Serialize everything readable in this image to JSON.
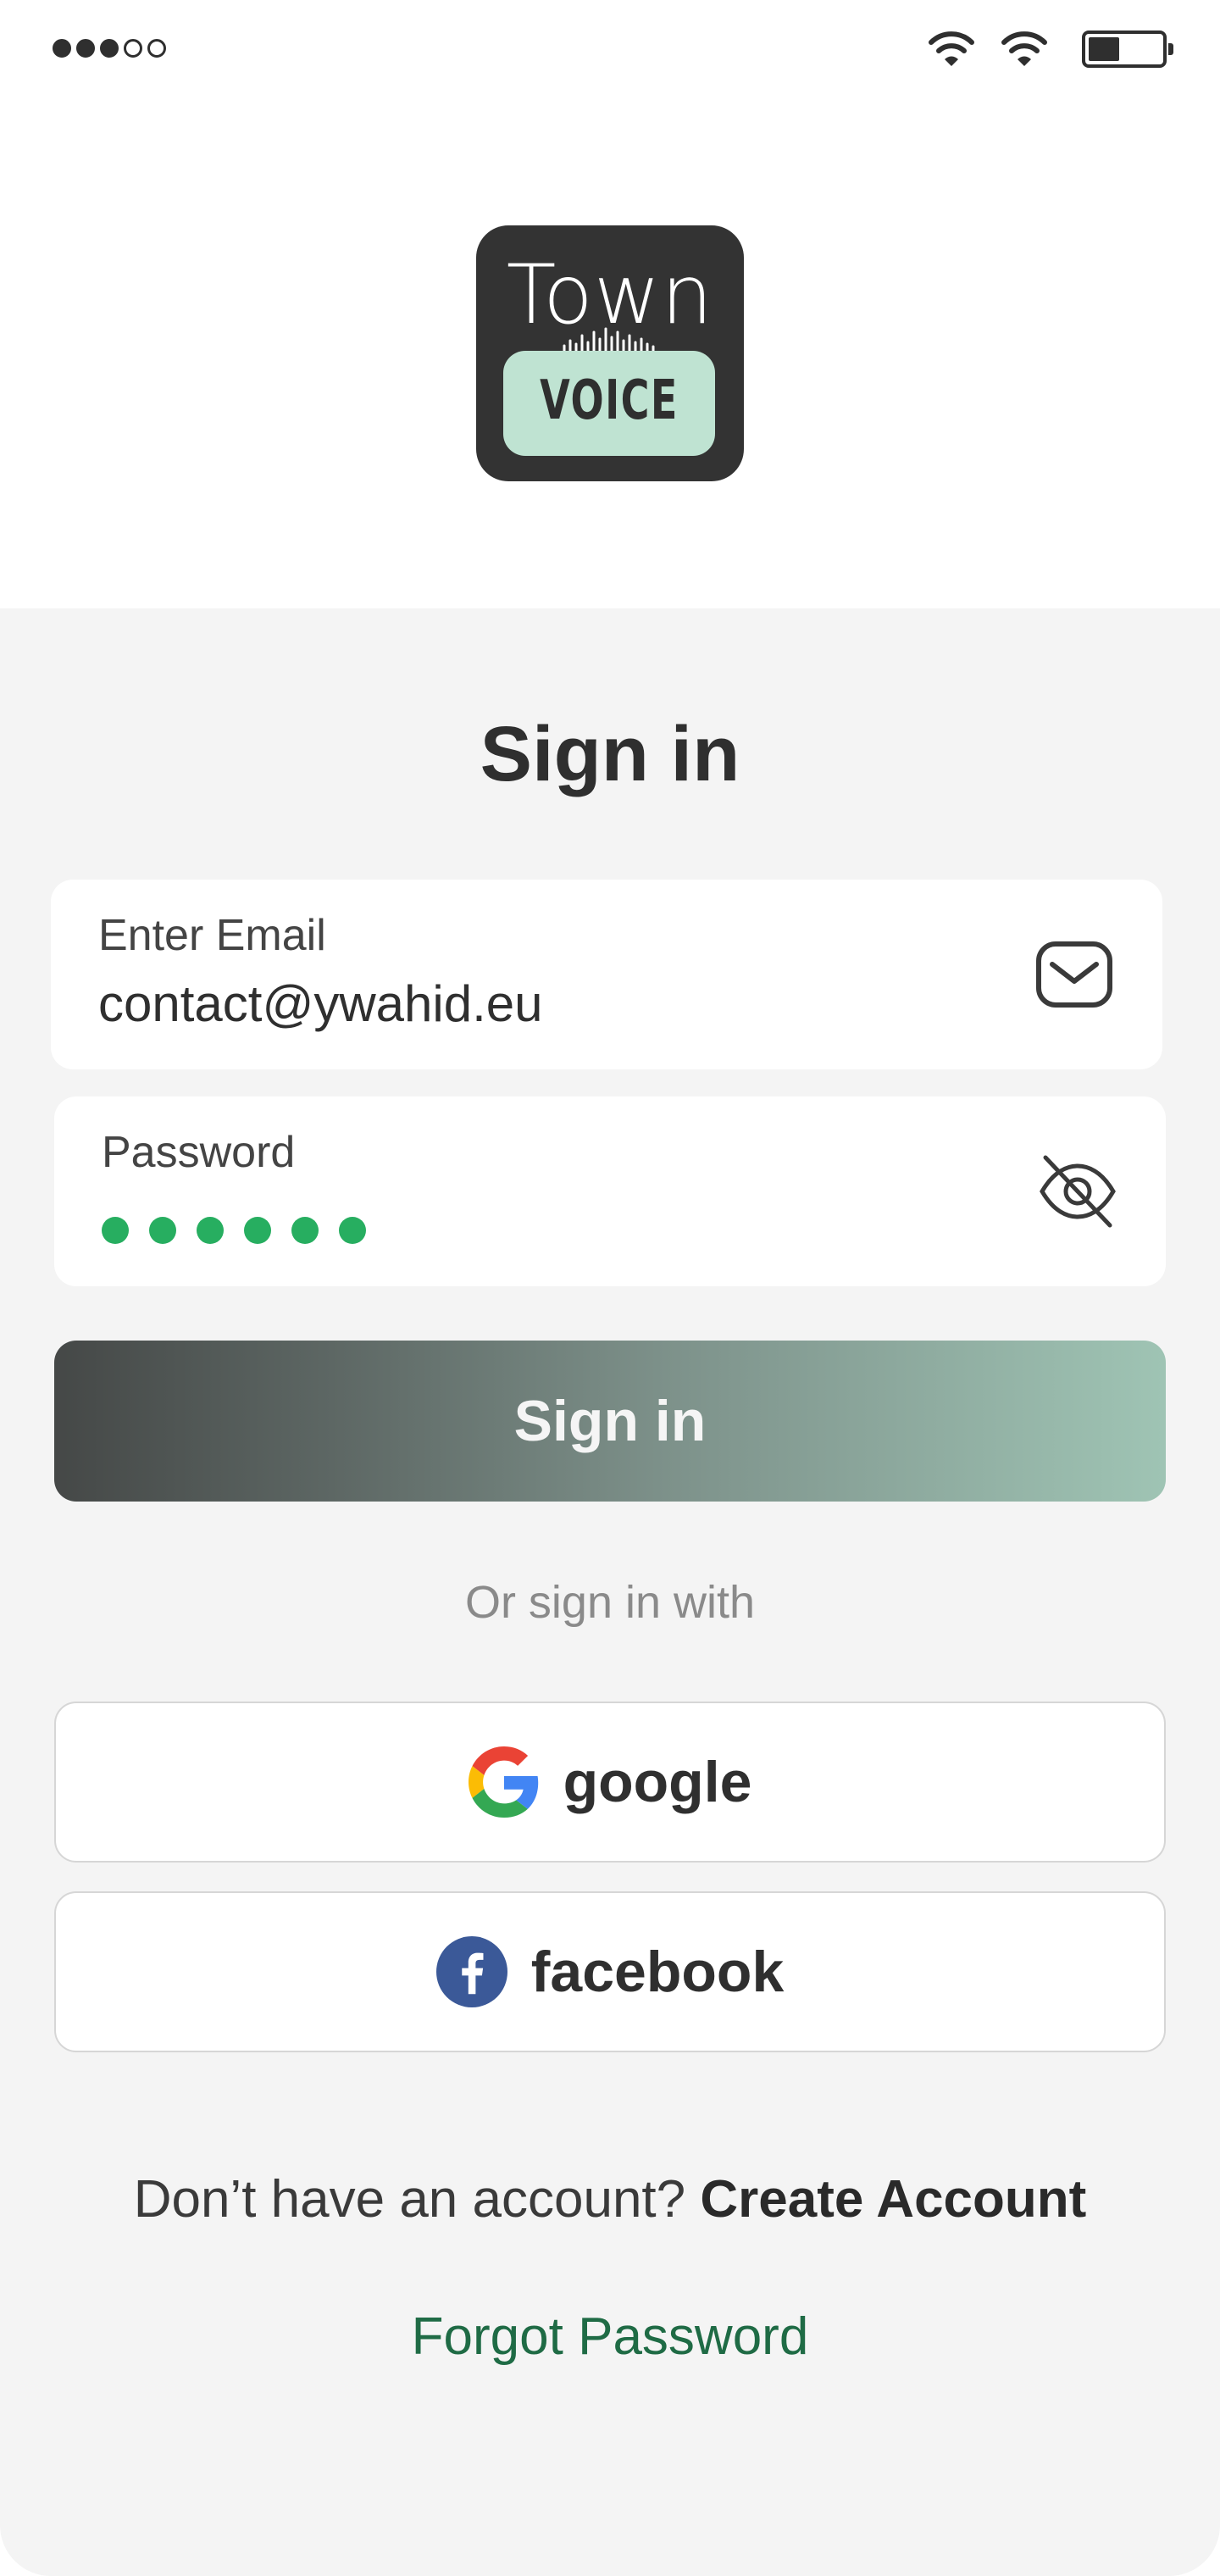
{
  "logo": {
    "line1": "Town",
    "line2": "VOICE",
    "background_color": "#333333",
    "badge_color": "#bfe3d2"
  },
  "status_bar": {
    "signal_dots_filled": 3,
    "signal_dots_total": 5,
    "icons": [
      "signal-dots-icon",
      "wifi-icon",
      "wifi-icon",
      "battery-icon"
    ]
  },
  "form": {
    "title": "Sign in",
    "email": {
      "label": "Enter Email",
      "value": "contact@ywahid.eu",
      "icon": "mail-icon"
    },
    "password": {
      "label": "Password",
      "masked_length": 6,
      "icon": "eye-off-icon",
      "dot_color": "#27ae60"
    },
    "submit_label": "Sign in"
  },
  "social": {
    "divider_text": "Or sign in with",
    "google_label": "google",
    "facebook_label": "facebook",
    "facebook_color": "#3b5998"
  },
  "footer": {
    "account_prompt": "Don’t have an account? ",
    "create_account": "Create Account",
    "forgot_password": "Forgot Password",
    "forgot_color": "#1f6b45"
  }
}
